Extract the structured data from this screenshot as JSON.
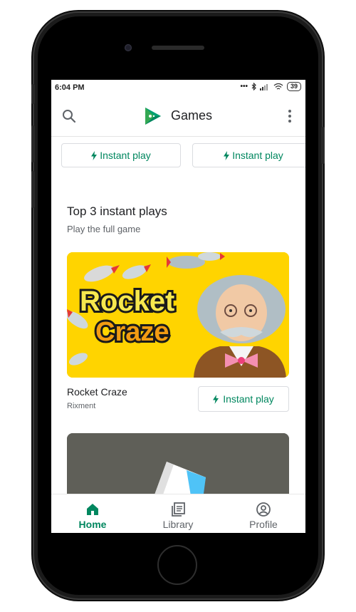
{
  "status_bar": {
    "time": "6:04 PM",
    "indicators": "... ✱ .❙",
    "battery": "39"
  },
  "app_bar": {
    "title": "Games",
    "search_icon": "search-icon",
    "menu_icon": "more-vert-icon"
  },
  "chips": [
    {
      "label": "Instant play"
    },
    {
      "label": "Instant play"
    }
  ],
  "section": {
    "title": "Top 3 instant plays",
    "subtitle": "Play the full game"
  },
  "featured_game": {
    "banner_text_line1": "Rocket",
    "banner_text_line2": "Craze",
    "name": "Rocket Craze",
    "developer": "Rixment",
    "action_label": "Instant play"
  },
  "bottom_nav": {
    "items": [
      {
        "label": "Home",
        "icon": "home-icon",
        "active": true
      },
      {
        "label": "Library",
        "icon": "library-icon",
        "active": false
      },
      {
        "label": "Profile",
        "icon": "profile-icon",
        "active": false
      }
    ]
  },
  "colors": {
    "accent": "#01875f",
    "banner_bg": "#ffd700",
    "text_primary": "#202124",
    "text_secondary": "#5f6368"
  }
}
